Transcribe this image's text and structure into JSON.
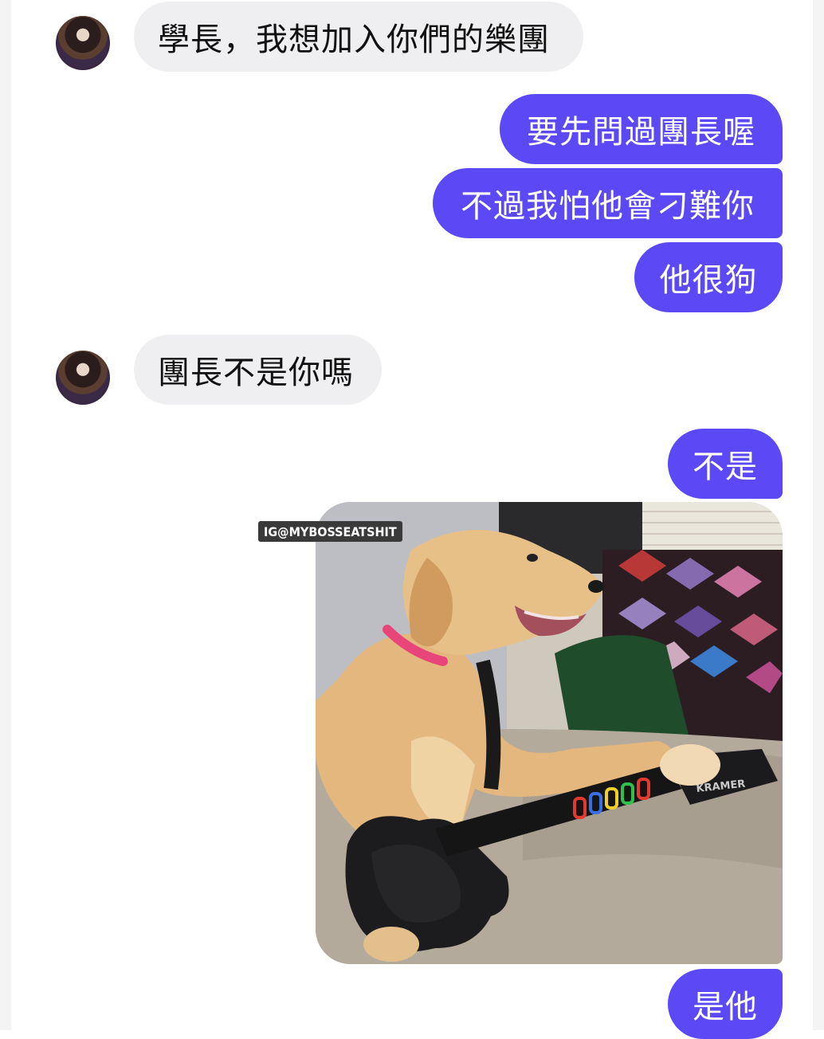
{
  "messages": {
    "m1": "學長，我想加入你們的樂團",
    "m2": "要先問過團長喔",
    "m3": "不過我怕他會刁難你",
    "m4": "他很狗",
    "m5": "團長不是你嗎",
    "m6": "不是",
    "m7": "是他"
  },
  "photo": {
    "watermark": "IG@MYBOSSEATSHIT",
    "guitar_brand": "KRAMER",
    "subject_icon": "dog-playing-guitar-photo"
  },
  "colors": {
    "outgoing_bubble": "#5a49f5",
    "incoming_bubble": "#efeff1",
    "background": "#ffffff"
  }
}
